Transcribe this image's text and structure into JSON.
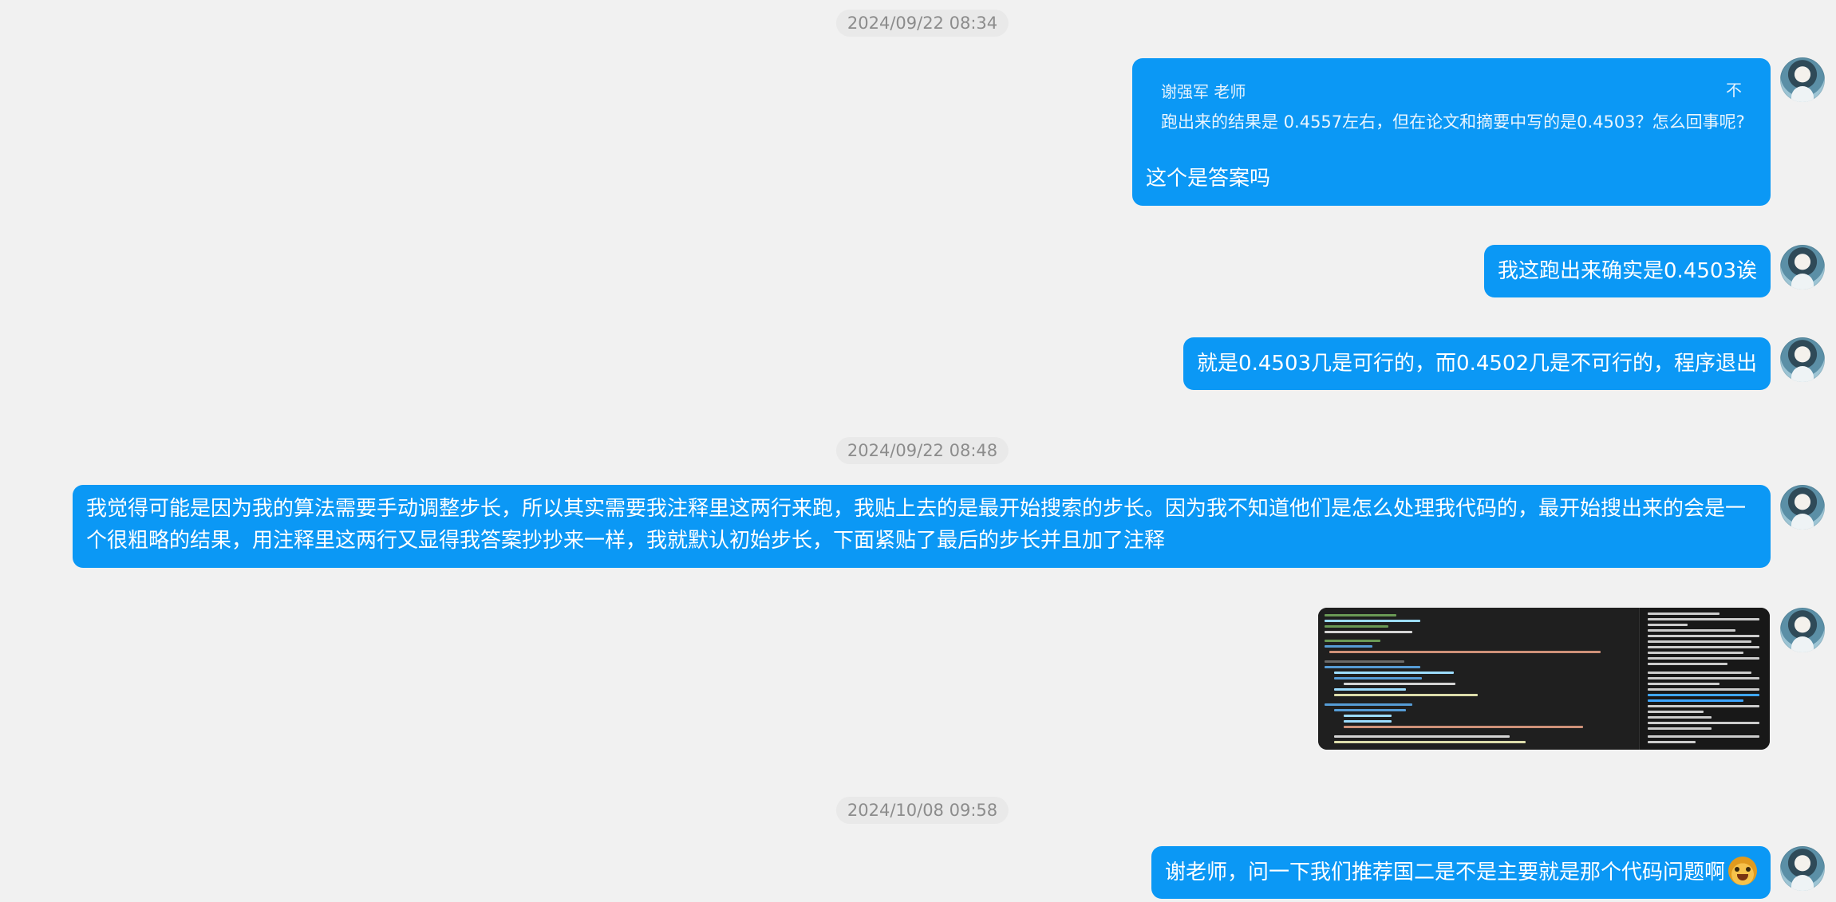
{
  "messages": [
    {
      "timestamp": "2024/09/22 08:34"
    },
    {
      "quote": {
        "author": "谢强军 老师",
        "close_label": "不",
        "text": "跑出来的结果是 0.4557左右，但在论文和摘要中写的是0.4503？怎么回事呢?"
      },
      "reply": "这个是答案吗"
    },
    {
      "text": "我这跑出来确实是0.4503诶"
    },
    {
      "text": "就是0.4503几是可行的，而0.4502几是不可行的，程序退出"
    },
    {
      "timestamp": "2024/09/22 08:48"
    },
    {
      "text": "我觉得可能是因为我的算法需要手动调整步长，所以其实需要我注释里这两行来跑，我贴上去的是最开始搜索的步长。因为我不知道他们是怎么处理我代码的，最开始搜出来的会是一个很粗略的结果，用注释里这两行又显得我答案抄抄来一样，我就默认初始步长，下面紧贴了最后的步长并且加了注释"
    },
    {
      "image": "code-screenshot"
    },
    {
      "timestamp": "2024/10/08 09:58"
    },
    {
      "text": "谢老师，问一下我们推荐国二是不是主要就是那个代码问题啊",
      "emoji": "surprised-face-emoji"
    }
  ],
  "colors": {
    "bubble": "#0b98f5",
    "background": "#f1f1f1",
    "timestamp_text": "#8c8c8c",
    "timestamp_bg": "#e9e9e9"
  }
}
